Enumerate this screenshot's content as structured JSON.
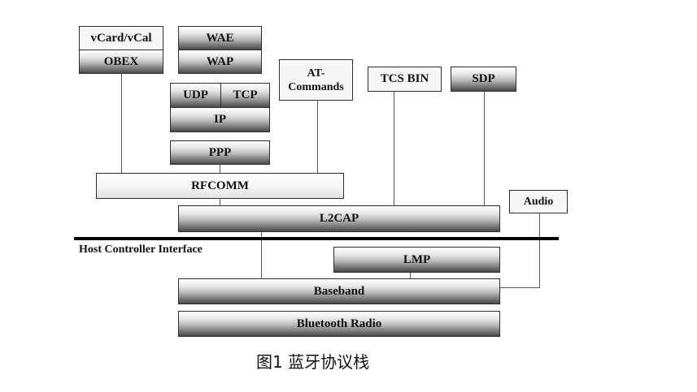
{
  "blocks": {
    "vcard": "vCard/vCal",
    "obex": "OBEX",
    "wae": "WAE",
    "wap": "WAP",
    "udp": "UDP",
    "tcp": "TCP",
    "ip": "IP",
    "ppp": "PPP",
    "at_commands": "AT-Commands",
    "tcs_bin": "TCS BIN",
    "sdp": "SDP",
    "rfcomm": "RFCOMM",
    "audio": "Audio",
    "l2cap": "L2CAP",
    "lmp": "LMP",
    "baseband": "Baseband",
    "bluetooth_radio": "Bluetooth Radio"
  },
  "hci_label": "Host Controller Interface",
  "caption": "图1  蓝牙协议栈"
}
